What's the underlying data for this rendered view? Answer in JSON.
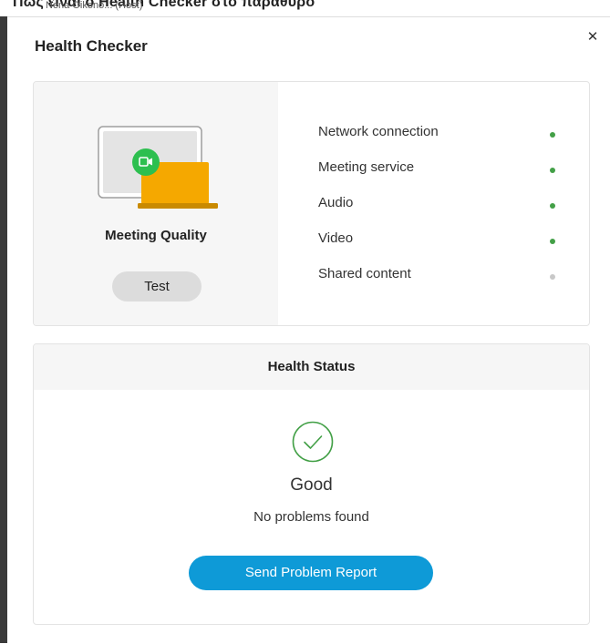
{
  "background": {
    "header_text": "Πώς είναι ο Health Checker στο παράθυρο",
    "participant": "Nena Oikono...  (Host)"
  },
  "dialog": {
    "title": "Health Checker",
    "close_icon": "close-icon"
  },
  "meeting_quality": {
    "illustration_icon": "laptop-video-icon",
    "label": "Meeting Quality",
    "test_button": "Test"
  },
  "checks": [
    {
      "label": "Network connection",
      "status": "good",
      "color": "#43a047"
    },
    {
      "label": "Meeting service",
      "status": "good",
      "color": "#43a047"
    },
    {
      "label": "Audio",
      "status": "good",
      "color": "#43a047"
    },
    {
      "label": "Video",
      "status": "good",
      "color": "#43a047"
    },
    {
      "label": "Shared content",
      "status": "inactive",
      "color": "#c8c8c8"
    }
  ],
  "health_status": {
    "header": "Health Status",
    "icon": "check-circle-icon",
    "status": "Good",
    "message": "No problems found",
    "report_button": "Send Problem Report"
  },
  "colors": {
    "accent": "#0e9ad7",
    "good": "#43a047",
    "video_badge": "#2dbf4f",
    "laptop": "#f5a800"
  }
}
